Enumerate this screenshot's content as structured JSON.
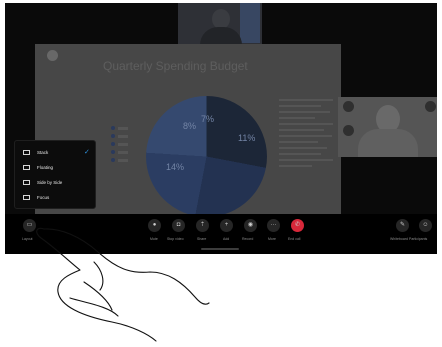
{
  "share": {
    "title": "Quarterly Spending Budget",
    "pie_labels": [
      "8%",
      "7%",
      "14%",
      "11%"
    ]
  },
  "layout_menu": {
    "items": [
      {
        "label": "Stack",
        "selected": true
      },
      {
        "label": "Floating",
        "selected": false
      },
      {
        "label": "Side by Side",
        "selected": false
      },
      {
        "label": "Focus",
        "selected": false
      }
    ],
    "check": "✓"
  },
  "toolbar": {
    "layout_label": "Layout",
    "buttons": [
      {
        "label": "Mute",
        "icon": "mic-icon"
      },
      {
        "label": "Stop video",
        "icon": "camera-icon"
      },
      {
        "label": "Share",
        "icon": "share-icon"
      },
      {
        "label": "Add",
        "icon": "add-icon"
      },
      {
        "label": "Record",
        "icon": "record-icon"
      },
      {
        "label": "More",
        "icon": "more-icon"
      },
      {
        "label": "End call",
        "icon": "end-call-icon"
      }
    ],
    "right_buttons": [
      {
        "label": "Whiteboard",
        "icon": "whiteboard-icon"
      },
      {
        "label": "Participants",
        "icon": "participants-icon"
      }
    ]
  },
  "colors": {
    "end_call": "#d8283a",
    "check": "#2f93e0"
  }
}
